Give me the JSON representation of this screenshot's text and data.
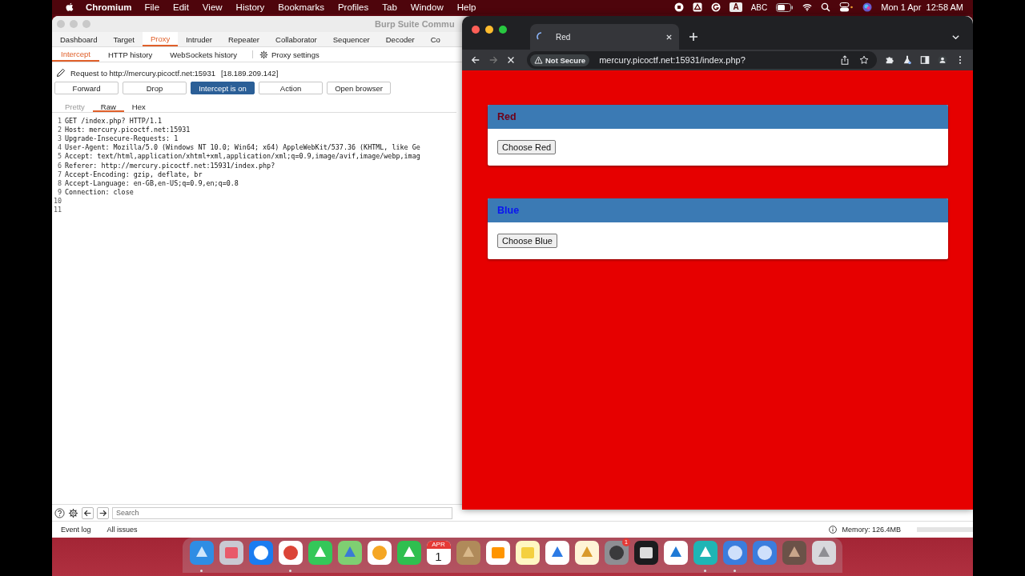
{
  "menu_bar": {
    "app": "Chromium",
    "menus": [
      "File",
      "Edit",
      "View",
      "History",
      "Bookmarks",
      "Profiles",
      "Tab",
      "Window",
      "Help"
    ],
    "input_source": "A",
    "input_label": "ABC",
    "clock": "Mon 1 Apr  12:58 AM"
  },
  "burp": {
    "title": "Burp Suite Commu",
    "tabs": [
      {
        "label": "Dashboard",
        "selected": false
      },
      {
        "label": "Target",
        "selected": false
      },
      {
        "label": "Proxy",
        "selected": true
      },
      {
        "label": "Intruder",
        "selected": false
      },
      {
        "label": "Repeater",
        "selected": false
      },
      {
        "label": "Collaborator",
        "selected": false
      },
      {
        "label": "Sequencer",
        "selected": false
      },
      {
        "label": "Decoder",
        "selected": false
      },
      {
        "label": "Co",
        "selected": false
      }
    ],
    "subtabs": [
      {
        "label": "Intercept",
        "selected": true
      },
      {
        "label": "HTTP history",
        "selected": false
      },
      {
        "label": "WebSockets history",
        "selected": false
      }
    ],
    "settings_link": "Proxy settings",
    "request_url": "Request to http://mercury.picoctf.net:15931",
    "request_ip": "[18.189.209.142]",
    "buttons": [
      {
        "label": "Forward",
        "on": false
      },
      {
        "label": "Drop",
        "on": false
      },
      {
        "label": "Intercept is on",
        "on": true
      },
      {
        "label": "Action",
        "on": false
      },
      {
        "label": "Open browser",
        "on": false
      }
    ],
    "editor_tabs": [
      {
        "label": "Pretty",
        "selected": false,
        "disabled": true
      },
      {
        "label": "Raw",
        "selected": true,
        "disabled": false
      },
      {
        "label": "Hex",
        "selected": false,
        "disabled": false
      }
    ],
    "lines": [
      {
        "number": "1",
        "text": "GET /index.php? HTTP/1.1"
      },
      {
        "number": "2",
        "text": "Host: mercury.picoctf.net:15931"
      },
      {
        "number": "3",
        "text": "Upgrade-Insecure-Requests: 1"
      },
      {
        "number": "4",
        "text": "User-Agent: Mozilla/5.0 (Windows NT 10.0; Win64; x64) AppleWebKit/537.36 (KHTML, like Ge"
      },
      {
        "number": "5",
        "text": "Accept: text/html,application/xhtml+xml,application/xml;q=0.9,image/avif,image/webp,imag"
      },
      {
        "number": "6",
        "text": "Referer: http://mercury.picoctf.net:15931/index.php?"
      },
      {
        "number": "7",
        "text": "Accept-Encoding: gzip, deflate, br"
      },
      {
        "number": "8",
        "text": "Accept-Language: en-GB,en-US;q=0.9,en;q=0.8"
      },
      {
        "number": "9",
        "text": "Connection: close"
      },
      {
        "number": "10"
      },
      {
        "number": "11"
      }
    ],
    "search": {
      "placeholder": "Search"
    },
    "status_bar": {
      "items": [
        "Event log",
        "All issues"
      ],
      "memory": "Memory: 126.4MB"
    }
  },
  "browser": {
    "tab": {
      "title": "Red",
      "loading": true
    },
    "not_secure": "Not Secure",
    "url": "mercury.picoctf.net:15931/index.php?",
    "cards": [
      {
        "title": "Red",
        "color": "#6e0018",
        "button": "Choose Red"
      },
      {
        "title": "Blue",
        "color": "#0a14f0",
        "button": "Choose Blue"
      }
    ]
  },
  "dock": {
    "apps": [
      {
        "kind": "finder",
        "running": true
      },
      {
        "kind": "launchpad",
        "running": false
      },
      {
        "kind": "safari",
        "running": false
      },
      {
        "kind": "chrome",
        "running": true
      },
      {
        "kind": "messages",
        "running": false
      },
      {
        "kind": "maps",
        "running": false
      },
      {
        "kind": "photos",
        "running": false
      },
      {
        "kind": "facetime",
        "running": false
      },
      {
        "kind": "calendar",
        "running": false,
        "month": "APR",
        "day": "1"
      },
      {
        "kind": "contacts",
        "running": false
      },
      {
        "kind": "reminders",
        "running": false
      },
      {
        "kind": "notes",
        "running": false
      },
      {
        "kind": "freeform",
        "running": false
      },
      {
        "kind": "pen",
        "running": false
      },
      {
        "kind": "settings",
        "running": false,
        "badge": "1"
      },
      {
        "kind": "terminal",
        "running": false
      },
      {
        "kind": "vscode",
        "running": false
      },
      {
        "kind": "bolt",
        "running": true
      },
      {
        "kind": "chromium",
        "running": true
      },
      {
        "kind": "chromium",
        "running": false
      },
      {
        "kind": "photo",
        "running": false
      },
      {
        "kind": "trash",
        "running": false
      }
    ]
  }
}
